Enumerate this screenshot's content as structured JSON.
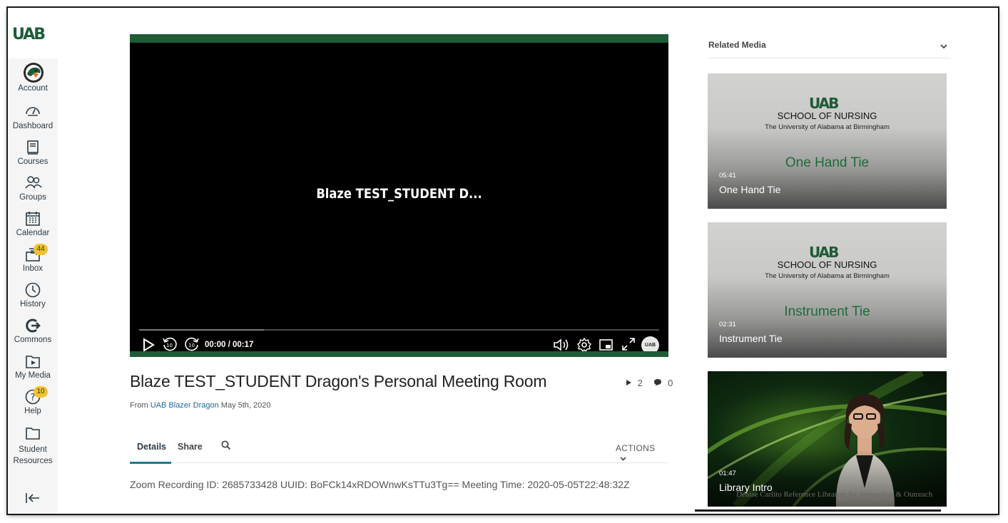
{
  "nav": {
    "logo_text": "UAB",
    "items": [
      {
        "label": "Account",
        "icon": "avatar-icon"
      },
      {
        "label": "Dashboard",
        "icon": "dashboard-icon"
      },
      {
        "label": "Courses",
        "icon": "courses-icon"
      },
      {
        "label": "Groups",
        "icon": "groups-icon"
      },
      {
        "label": "Calendar",
        "icon": "calendar-icon"
      },
      {
        "label": "Inbox",
        "icon": "inbox-icon",
        "badge": "44"
      },
      {
        "label": "History",
        "icon": "history-icon"
      },
      {
        "label": "Commons",
        "icon": "commons-icon"
      },
      {
        "label": "My Media",
        "icon": "my-media-icon"
      },
      {
        "label": "Help",
        "icon": "help-icon",
        "badge": "10"
      },
      {
        "label_line1": "Student",
        "label_line2": "Resources",
        "icon": "folder-icon"
      }
    ],
    "accent": "#1e5b37",
    "badge_color": "#f2c230"
  },
  "player": {
    "overlay_title": "Blaze TEST_STUDENT D...",
    "time": "00:00 / 00:17",
    "progress": 0,
    "buffered": 0.24,
    "skip_back": "10",
    "skip_forward": "10",
    "brand_button": "UAB"
  },
  "entry": {
    "title": "Blaze TEST_STUDENT Dragon's Personal Meeting Room",
    "plays": "2",
    "comments": "0",
    "from_prefix": "From",
    "owner": "UAB Blazer Dragon",
    "date": "May 5th, 2020",
    "tabs": [
      "Details",
      "Share"
    ],
    "actions_label": "ACTIONS",
    "description": "Zoom Recording ID: 2685733428 UUID: BoFCk14xRDOWnwKsTTu3Tg== Meeting Time: 2020-05-05T22:48:32Z"
  },
  "related": {
    "heading": "Related Media",
    "items": [
      {
        "logo": "UAB",
        "school": "SCHOOL OF NURSING",
        "university": "The University of Alabama at Birmingham",
        "big_title": "One Hand Tie",
        "duration": "05:41",
        "name": "One Hand Tie"
      },
      {
        "logo": "UAB",
        "school": "SCHOOL OF NURSING",
        "university": "The University of Alabama at Birmingham",
        "big_title": "Instrument Tie",
        "duration": "02:31",
        "name": "Instrument Tie"
      },
      {
        "duration": "01:47",
        "name": "Library Intro",
        "watermark": "Denise Carlito Reference Librarian for Instruction & Outreach"
      }
    ]
  }
}
